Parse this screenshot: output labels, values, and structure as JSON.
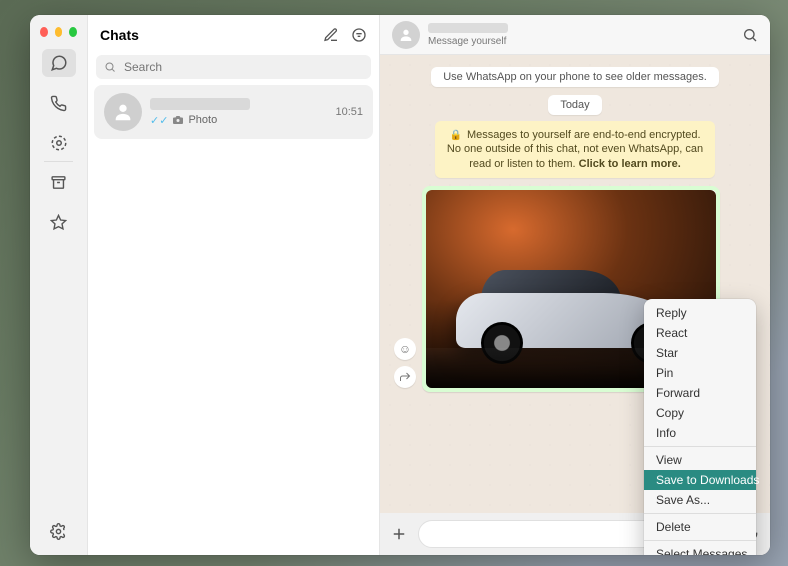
{
  "sidebar": {
    "items": [
      {
        "name": "chats",
        "label": "Chats"
      },
      {
        "name": "calls",
        "label": "Calls"
      },
      {
        "name": "status",
        "label": "Status"
      },
      {
        "name": "archived",
        "label": "Archived"
      },
      {
        "name": "starred",
        "label": "Starred"
      }
    ],
    "bottom": {
      "name": "settings",
      "label": "Settings"
    }
  },
  "chats_panel": {
    "title": "Chats",
    "search_placeholder": "Search",
    "chat": {
      "preview_icon": "camera",
      "preview_text": "Photo",
      "time": "10:51",
      "delivered": true
    }
  },
  "conversation": {
    "subtitle": "Message yourself",
    "older_banner": "Use WhatsApp on your phone to see older messages.",
    "today_label": "Today",
    "encryption_notice": "Messages to yourself are end-to-end encrypted. No one outside of this chat, not even WhatsApp, can read or listen to them.",
    "encryption_cta": "Click to learn more.",
    "message": {
      "type": "photo",
      "alt": "Silver concept sports car in a classical hall with columns and warm lighting"
    }
  },
  "context_menu": {
    "groups": [
      [
        "Reply",
        "React",
        "Star",
        "Pin",
        "Forward",
        "Copy",
        "Info"
      ],
      [
        "View",
        "Save to Downloads",
        "Save As..."
      ],
      [
        "Delete"
      ],
      [
        "Select Messages"
      ]
    ],
    "highlighted": "Save to Downloads"
  }
}
